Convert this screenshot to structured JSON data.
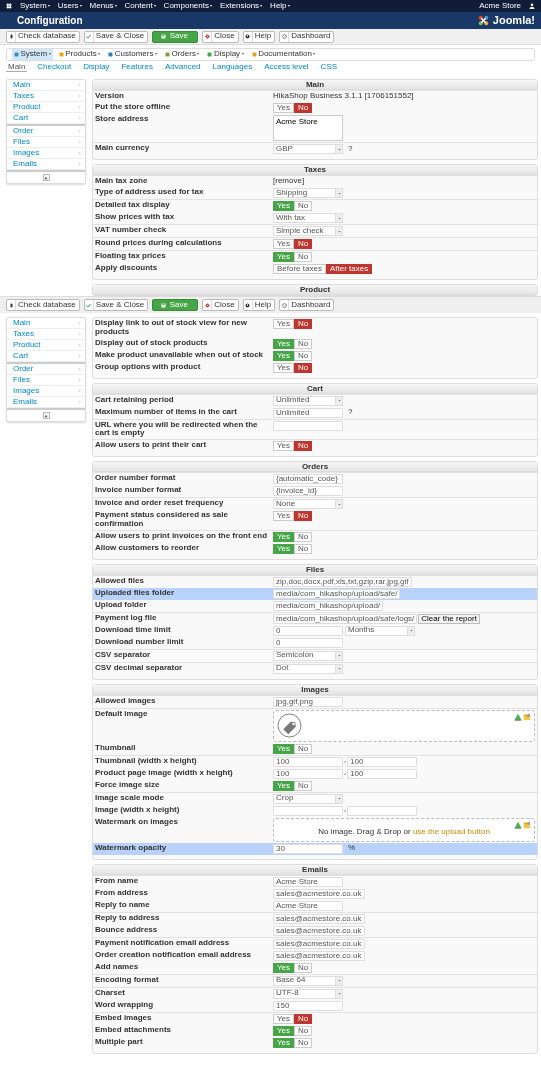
{
  "topbar": {
    "menus": [
      "System",
      "Users",
      "Menus",
      "Content",
      "Components",
      "Extensions",
      "Help"
    ],
    "user": "Acme Store"
  },
  "header": {
    "title": "Configuration",
    "logo": "Joomla!"
  },
  "toolbars": [
    [
      {
        "label": "Check database",
        "kind": "database"
      },
      {
        "label": "Save & Close",
        "kind": "check"
      },
      {
        "label": "Save",
        "kind": "save"
      },
      {
        "label": "Close",
        "kind": "close"
      },
      {
        "label": "Help",
        "kind": "help"
      },
      {
        "label": "Dashboard",
        "kind": "dashboard"
      }
    ],
    [
      {
        "label": "Check database",
        "kind": "database"
      },
      {
        "label": "Save & Close",
        "kind": "check"
      },
      {
        "label": "Save",
        "kind": "save"
      },
      {
        "label": "Close",
        "kind": "close"
      },
      {
        "label": "Help",
        "kind": "help"
      },
      {
        "label": "Dashboard",
        "kind": "dashboard"
      }
    ]
  ],
  "submenu": [
    {
      "label": "System",
      "kind": "system",
      "selected": true
    },
    {
      "label": "Products",
      "kind": "products",
      "selected": false
    },
    {
      "label": "Customers",
      "kind": "customers",
      "selected": false
    },
    {
      "label": "Orders",
      "kind": "orders",
      "selected": false
    },
    {
      "label": "Display",
      "kind": "display",
      "selected": false
    },
    {
      "label": "Documentation",
      "kind": "docs",
      "selected": false
    }
  ],
  "tabs": [
    {
      "label": "Main",
      "selected": true
    },
    {
      "label": "Checkout",
      "selected": false
    },
    {
      "label": "Display",
      "selected": false
    },
    {
      "label": "Features",
      "selected": false
    },
    {
      "label": "Advanced",
      "selected": false
    },
    {
      "label": "Languages",
      "selected": false
    },
    {
      "label": "Access level",
      "selected": false
    },
    {
      "label": "CSS",
      "selected": false
    }
  ],
  "screens": [
    {
      "sidebar": [
        [
          "Main",
          "Taxes",
          "Product",
          "Cart"
        ],
        [
          "Order",
          "Files",
          "Images",
          "Emails"
        ]
      ],
      "sections": [
        {
          "title": "Main",
          "groups": [
            [
              {
                "kind": "text",
                "label": "Version",
                "value": "HikaShop Business 3.1.1 [1706151552]"
              },
              {
                "kind": "toggle",
                "label": "Put the store offline",
                "options": [
                  {
                    "label": "Yes",
                    "selected": false
                  },
                  {
                    "label": "No",
                    "selected": true
                  }
                ]
              },
              {
                "kind": "textarea",
                "label": "Store address",
                "value": "Acme Store"
              }
            ],
            [
              {
                "kind": "select",
                "label": "Main currency",
                "value": "GBP",
                "suffix": "?"
              }
            ]
          ]
        },
        {
          "title": "Taxes",
          "groups": [
            [
              {
                "kind": "text",
                "label": "Main tax zone",
                "value": "[remove]"
              },
              {
                "kind": "select",
                "label": "Type of address used for tax",
                "value": "Shipping"
              }
            ],
            [
              {
                "kind": "toggle",
                "label": "Detailed tax display",
                "options": [
                  {
                    "label": "Yes",
                    "selected": true
                  },
                  {
                    "label": "No",
                    "selected": false
                  }
                ]
              },
              {
                "kind": "select",
                "label": "Show prices with tax",
                "value": "With tax"
              }
            ],
            [
              {
                "kind": "select",
                "label": "VAT number check",
                "value": "Simple check"
              }
            ],
            [
              {
                "kind": "toggle",
                "label": "Round prices during calculations",
                "options": [
                  {
                    "label": "Yes",
                    "selected": false
                  },
                  {
                    "label": "No",
                    "selected": true
                  }
                ]
              }
            ],
            [
              {
                "kind": "toggle",
                "label": "Floating tax prices",
                "options": [
                  {
                    "label": "Yes",
                    "selected": true
                  },
                  {
                    "label": "No",
                    "selected": false
                  }
                ]
              },
              {
                "kind": "toggle",
                "label": "Apply discounts",
                "options": [
                  {
                    "label": "Before taxes",
                    "selected": false
                  },
                  {
                    "label": "After taxes",
                    "selected": true
                  }
                ]
              }
            ]
          ]
        },
        {
          "title": "Product"
        }
      ]
    },
    {
      "sidebar": [
        [
          "Main",
          "Taxes",
          "Product",
          "Cart"
        ],
        [
          "Order",
          "Files",
          "Images",
          "Emails"
        ]
      ],
      "sections": [
        {
          "groups": [
            [
              {
                "kind": "toggle",
                "label": "Display link to out of stock view for new products",
                "options": [
                  {
                    "label": "Yes",
                    "selected": false
                  },
                  {
                    "label": "No",
                    "selected": true
                  }
                ]
              },
              {
                "kind": "toggle",
                "label": "Display out of stock products",
                "options": [
                  {
                    "label": "Yes",
                    "selected": true
                  },
                  {
                    "label": "No",
                    "selected": false
                  }
                ]
              },
              {
                "kind": "toggle",
                "label": "Make product unavailable when out of stock",
                "options": [
                  {
                    "label": "Yes",
                    "selected": true
                  },
                  {
                    "label": "No",
                    "selected": false
                  }
                ]
              },
              {
                "kind": "toggle",
                "label": "Group options with product",
                "options": [
                  {
                    "label": "Yes",
                    "selected": false
                  },
                  {
                    "label": "No",
                    "selected": true
                  }
                ]
              }
            ]
          ]
        },
        {
          "title": "Cart",
          "groups": [
            [
              {
                "kind": "select",
                "label": "Cart retaining period",
                "value": "Unlimited"
              },
              {
                "kind": "input",
                "label": "Maximum number of items in the cart",
                "value": "Unlimited",
                "suffix": "?"
              }
            ],
            [
              {
                "kind": "input",
                "label": "URL where you will be redirected when the cart is empty"
              }
            ],
            [
              {
                "kind": "toggle",
                "label": "Allow users to print their cart",
                "options": [
                  {
                    "label": "Yes",
                    "selected": false
                  },
                  {
                    "label": "No",
                    "selected": true
                  }
                ]
              }
            ]
          ]
        },
        {
          "title": "Orders",
          "groups": [
            [
              {
                "kind": "input",
                "label": "Order number format",
                "value": "{automatic_code}"
              },
              {
                "kind": "input",
                "label": "Invoice number format",
                "value": "{invoice_id}"
              }
            ],
            [
              {
                "kind": "select",
                "label": "Invoice and order reset frequency",
                "value": "None"
              },
              {
                "kind": "toggle",
                "label": "Payment status considered as sale confirmation",
                "options": [
                  {
                    "label": "Yes",
                    "selected": false
                  },
                  {
                    "label": "No",
                    "selected": true
                  }
                ]
              }
            ],
            [
              {
                "kind": "toggle",
                "label": "Allow users to print invoices on the front end",
                "options": [
                  {
                    "label": "Yes",
                    "selected": true
                  },
                  {
                    "label": "No",
                    "selected": false
                  }
                ]
              },
              {
                "kind": "toggle",
                "label": "Allow customers to reorder",
                "options": [
                  {
                    "label": "Yes",
                    "selected": true
                  },
                  {
                    "label": "No",
                    "selected": false
                  }
                ]
              }
            ]
          ]
        },
        {
          "title": "Files",
          "groups": [
            [
              {
                "kind": "input",
                "label": "Allowed files",
                "value": "zip,doc,docx,pdf,xls,txt,gzip,rar,jpg,gif"
              },
              {
                "kind": "input",
                "label": "Uploaded files folder",
                "value": "media/com_hikashop/upload/safe/",
                "highlighted": true
              },
              {
                "kind": "input",
                "label": "Upload folder",
                "value": "media/com_hikashop/upload/"
              }
            ],
            [
              {
                "kind": "input_button",
                "label": "Payment log file",
                "value": "media/com_hikashop/upload/safe/logs/",
                "button": "Clear the report"
              },
              {
                "kind": "input_select",
                "label": "Download time limit",
                "value": "0",
                "choice": "Months"
              },
              {
                "kind": "input",
                "label": "Download number limit",
                "value": "0"
              }
            ],
            [
              {
                "kind": "select",
                "label": "CSV separator",
                "value": "Semicolon"
              }
            ],
            [
              {
                "kind": "select",
                "label": "CSV decimal separator",
                "value": "Dot"
              }
            ]
          ]
        },
        {
          "title": "Images",
          "groups": [
            [
              {
                "kind": "input",
                "label": "Allowed images",
                "value": "jpg,gif,png"
              }
            ],
            [
              {
                "kind": "dropzone",
                "label": "Default image",
                "has_picture": true
              },
              {
                "kind": "toggle",
                "label": "Thumbnail",
                "options": [
                  {
                    "label": "Yes",
                    "selected": true
                  },
                  {
                    "label": "No",
                    "selected": false
                  }
                ]
              }
            ],
            [
              {
                "kind": "pair",
                "label": "Thumbnail (width x height)",
                "value": "100",
                "value2": "100"
              },
              {
                "kind": "pair",
                "label": "Product page image (width x height)",
                "value": "100",
                "value2": "100"
              },
              {
                "kind": "toggle",
                "label": "Force image size",
                "options": [
                  {
                    "label": "Yes",
                    "selected": true
                  },
                  {
                    "label": "No",
                    "selected": false
                  }
                ]
              }
            ],
            [
              {
                "kind": "select",
                "label": "Image scale mode",
                "value": "Crop"
              },
              {
                "kind": "pair",
                "label": "Image (width x height)"
              },
              {
                "kind": "dropzone",
                "label": "Watermark on images",
                "has_picture": false,
                "hint": "No image. Drag & Drop or ",
                "hint_link": "use the upload button"
              },
              {
                "kind": "input",
                "label": "Watermark opacity",
                "value": "30",
                "suffix": "%",
                "highlighted": true
              }
            ]
          ]
        },
        {
          "title": "Emails",
          "groups": [
            [
              {
                "kind": "input",
                "label": "From name",
                "value": "Acme Store"
              },
              {
                "kind": "input",
                "label": "From address",
                "value": "sales@acmestore.co.uk"
              },
              {
                "kind": "input",
                "label": "Reply to name",
                "value": "Acme Store"
              }
            ],
            [
              {
                "kind": "input",
                "label": "Reply to address",
                "value": "sales@acmestore.co.uk"
              },
              {
                "kind": "input",
                "label": "Bounce address",
                "value": "sales@acmestore.co.uk"
              }
            ],
            [
              {
                "kind": "input",
                "label": "Payment notification email address",
                "value": "sales@acmestore.co.uk"
              },
              {
                "kind": "input",
                "label": "Order creation notification email address",
                "value": "sales@acmestore.co.uk"
              },
              {
                "kind": "toggle",
                "label": "Add names",
                "options": [
                  {
                    "label": "Yes",
                    "selected": true
                  },
                  {
                    "label": "No",
                    "selected": false
                  }
                ]
              }
            ],
            [
              {
                "kind": "select",
                "label": "Encoding format",
                "value": "Base 64"
              }
            ],
            [
              {
                "kind": "select",
                "label": "Charset",
                "value": "UTF-8"
              },
              {
                "kind": "input",
                "label": "Word wrapping",
                "value": "150"
              }
            ],
            [
              {
                "kind": "toggle",
                "label": "Embed images",
                "options": [
                  {
                    "label": "Yes",
                    "selected": false
                  },
                  {
                    "label": "No",
                    "selected": true
                  }
                ]
              },
              {
                "kind": "toggle",
                "label": "Embed attachments",
                "options": [
                  {
                    "label": "Yes",
                    "selected": true
                  },
                  {
                    "label": "No",
                    "selected": false
                  }
                ]
              },
              {
                "kind": "toggle",
                "label": "Multiple part",
                "options": [
                  {
                    "label": "Yes",
                    "selected": true
                  },
                  {
                    "label": "No",
                    "selected": false
                  }
                ]
              }
            ]
          ]
        }
      ]
    }
  ]
}
